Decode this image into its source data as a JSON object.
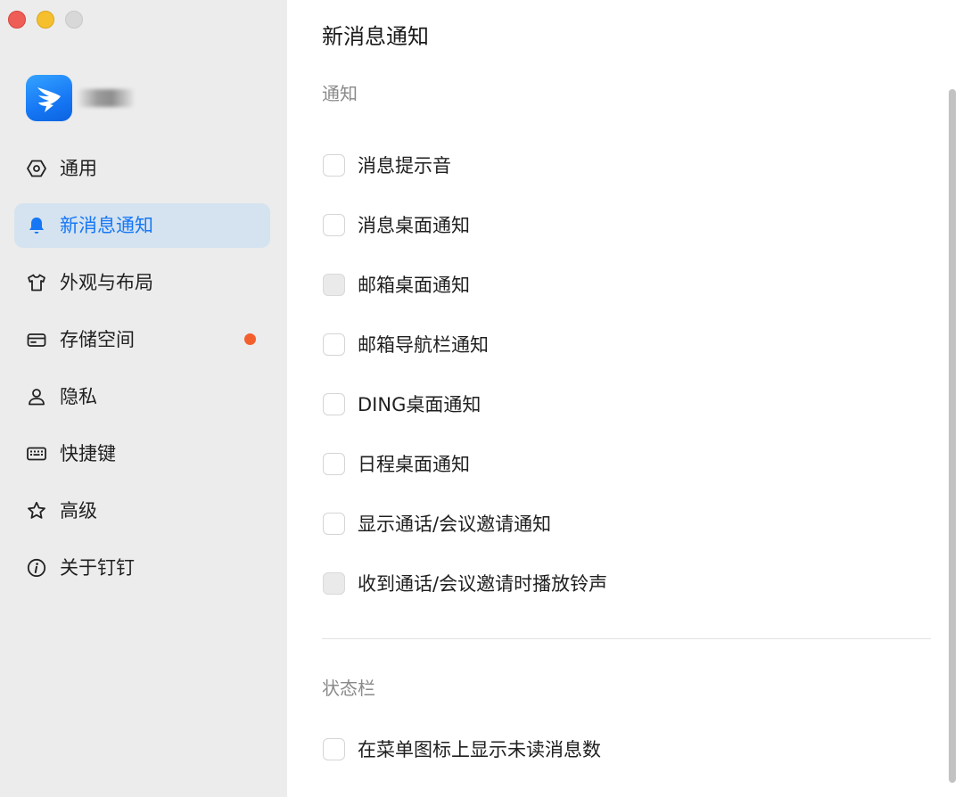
{
  "window": {
    "traffic_lights": [
      "close",
      "minimize",
      "zoom"
    ]
  },
  "sidebar": {
    "app_icon": "dingtalk-logo",
    "items": [
      {
        "label": "通用",
        "icon": "hexagon-gear-icon",
        "active": false,
        "badge": false
      },
      {
        "label": "新消息通知",
        "icon": "bell-icon",
        "active": true,
        "badge": false
      },
      {
        "label": "外观与布局",
        "icon": "shirt-icon",
        "active": false,
        "badge": false
      },
      {
        "label": "存储空间",
        "icon": "drive-icon",
        "active": false,
        "badge": true
      },
      {
        "label": "隐私",
        "icon": "person-icon",
        "active": false,
        "badge": false
      },
      {
        "label": "快捷键",
        "icon": "keyboard-icon",
        "active": false,
        "badge": false
      },
      {
        "label": "高级",
        "icon": "star-icon",
        "active": false,
        "badge": false
      },
      {
        "label": "关于钉钉",
        "icon": "info-icon",
        "active": false,
        "badge": false
      }
    ]
  },
  "main": {
    "title": "新消息通知",
    "sections": [
      {
        "title": "通知",
        "options": [
          {
            "label": "消息提示音",
            "checked": false,
            "disabled": false
          },
          {
            "label": "消息桌面通知",
            "checked": false,
            "disabled": false
          },
          {
            "label": "邮箱桌面通知",
            "checked": false,
            "disabled": true
          },
          {
            "label": "邮箱导航栏通知",
            "checked": false,
            "disabled": false
          },
          {
            "label": "DING桌面通知",
            "checked": false,
            "disabled": false
          },
          {
            "label": "日程桌面通知",
            "checked": false,
            "disabled": false
          },
          {
            "label": "显示通话/会议邀请通知",
            "checked": false,
            "disabled": false
          },
          {
            "label": "收到通话/会议邀请时播放铃声",
            "checked": false,
            "disabled": true
          }
        ]
      },
      {
        "title": "状态栏",
        "options": [
          {
            "label": "在菜单图标上显示未读消息数",
            "checked": false,
            "disabled": false
          }
        ]
      }
    ]
  },
  "colors": {
    "accent": "#1677f5",
    "active_bg": "#d5e3f0",
    "badge": "#f4602d",
    "sidebar_bg": "#ececec"
  }
}
